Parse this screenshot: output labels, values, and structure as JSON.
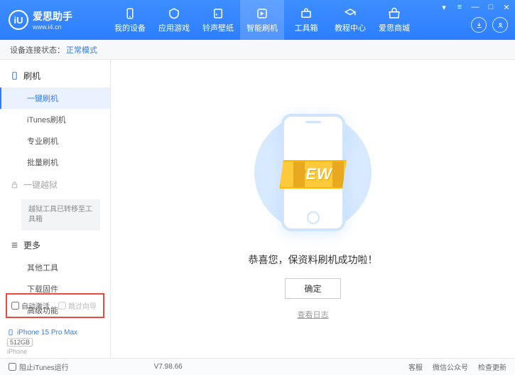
{
  "brand": {
    "title": "爱思助手",
    "url": "www.i4.cn",
    "logo_letter": "iU"
  },
  "win": {
    "menu": "▾",
    "cascade": "≡",
    "min": "—",
    "max": "□",
    "close": "✕"
  },
  "nav": [
    {
      "label": "我的设备"
    },
    {
      "label": "应用游戏"
    },
    {
      "label": "铃声壁纸"
    },
    {
      "label": "智能刷机"
    },
    {
      "label": "工具箱"
    },
    {
      "label": "教程中心"
    },
    {
      "label": "爱思商城"
    }
  ],
  "status_bar": {
    "label": "设备连接状态：",
    "value": "正常模式"
  },
  "sidebar": {
    "g1": "刷机",
    "g1_items": [
      "一键刷机",
      "iTunes刷机",
      "专业刷机",
      "批量刷机"
    ],
    "g2": "一键越狱",
    "g2_note": "越狱工具已转移至工具箱",
    "g3": "更多",
    "g3_items": [
      "其他工具",
      "下载固件",
      "高级功能"
    ],
    "chk1": "自动激活",
    "chk2": "跳过向导"
  },
  "device": {
    "name": "iPhone 15 Pro Max",
    "storage": "512GB",
    "type": "iPhone"
  },
  "content": {
    "ribbon": "NEW",
    "message": "恭喜您，保资料刷机成功啦！",
    "ok": "确定",
    "log": "查看日志"
  },
  "footer": {
    "block_itunes": "阻止iTunes运行",
    "version": "V7.98.66",
    "links": [
      "客服",
      "微信公众号",
      "检查更新"
    ]
  }
}
